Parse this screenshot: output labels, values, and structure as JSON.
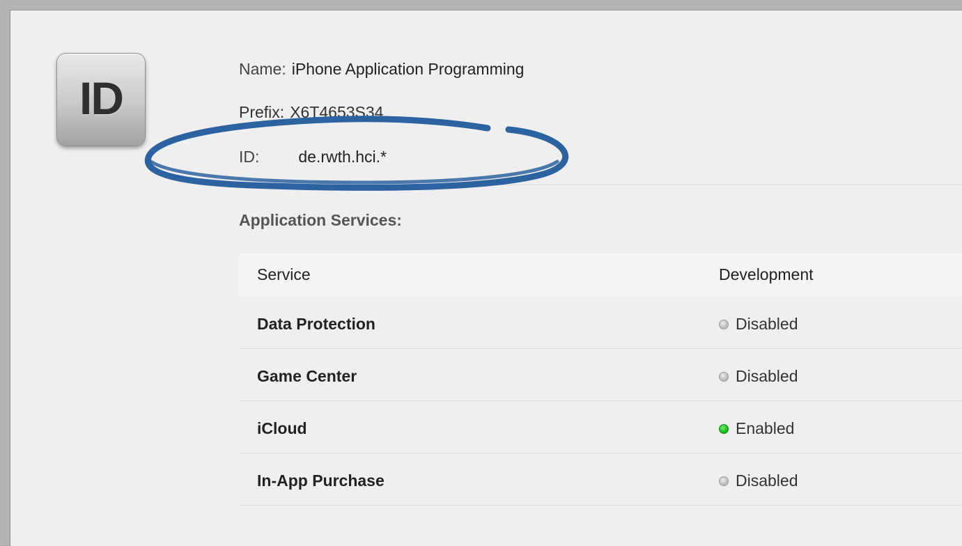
{
  "app_id": {
    "icon_text": "ID",
    "name_label": "Name:",
    "name_value": "iPhone Application Programming",
    "prefix_label": "Prefix:",
    "prefix_value": "X6T4653S34",
    "id_label": "ID:",
    "id_value": "de.rwth.hci.*"
  },
  "services": {
    "title": "Application Services:",
    "columns": [
      "Service",
      "Development"
    ],
    "rows": [
      {
        "name": "Data Protection",
        "status": "Disabled",
        "enabled": false
      },
      {
        "name": "Game Center",
        "status": "Disabled",
        "enabled": false
      },
      {
        "name": "iCloud",
        "status": "Enabled",
        "enabled": true
      },
      {
        "name": "In-App Purchase",
        "status": "Disabled",
        "enabled": false
      }
    ]
  },
  "colors": {
    "annotation_stroke": "#2d62a0",
    "enabled_dot": "#1ebc1e",
    "disabled_dot": "#bdbdbd"
  }
}
